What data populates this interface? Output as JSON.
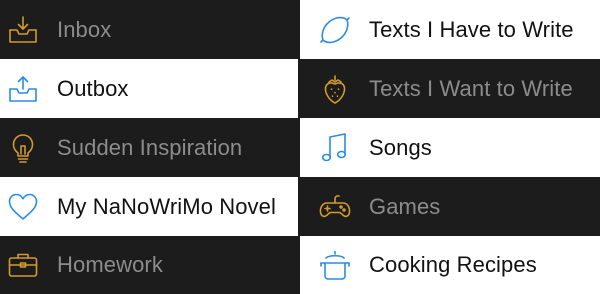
{
  "left_items": [
    {
      "label": "Inbox",
      "icon": "inbox-tray-icon",
      "selected": false
    },
    {
      "label": "Outbox",
      "icon": "outbox-tray-icon",
      "selected": true
    },
    {
      "label": "Sudden Inspiration",
      "icon": "lightbulb-icon",
      "selected": false
    },
    {
      "label": "My NaNoWriMo Novel",
      "icon": "heart-icon",
      "selected": true
    },
    {
      "label": "Homework",
      "icon": "briefcase-icon",
      "selected": false
    }
  ],
  "right_items": [
    {
      "label": "Texts I Have to Write",
      "icon": "lemon-icon",
      "selected": true
    },
    {
      "label": "Texts I Want to Write",
      "icon": "strawberry-icon",
      "selected": false
    },
    {
      "label": "Songs",
      "icon": "music-note-icon",
      "selected": true
    },
    {
      "label": "Games",
      "icon": "gamepad-icon",
      "selected": false
    },
    {
      "label": "Cooking Recipes",
      "icon": "cooking-pot-icon",
      "selected": true
    }
  ],
  "colors": {
    "dark_background": "#1c1c1c",
    "light_background": "#ffffff",
    "dark_label": "#8c8c8c",
    "light_label": "#111111",
    "accent_orange": "#d39a2c",
    "accent_blue": "#2a8be8"
  }
}
